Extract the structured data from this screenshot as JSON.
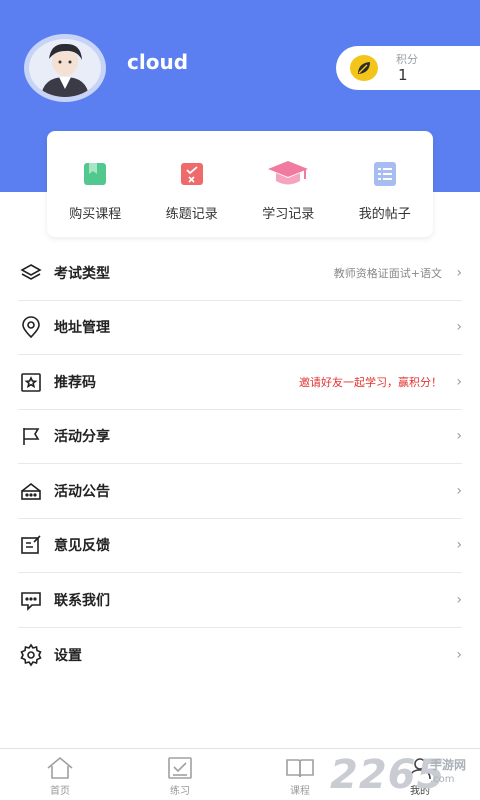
{
  "profile": {
    "username": "cloud",
    "points_label": "积分",
    "points_value": "1"
  },
  "quick_actions": [
    {
      "label": "购买课程",
      "icon": "book-icon",
      "color": "#52c78e"
    },
    {
      "label": "练题记录",
      "icon": "checklist-icon",
      "color": "#ef6b6b"
    },
    {
      "label": "学习记录",
      "icon": "graduation-cap-icon",
      "color": "#f07aa0"
    },
    {
      "label": "我的帖子",
      "icon": "list-document-icon",
      "color": "#7f9de8"
    }
  ],
  "menu": [
    {
      "label": "考试类型",
      "value": "教师资格证面试+语文",
      "icon": "layers-icon"
    },
    {
      "label": "地址管理",
      "value": "",
      "icon": "location-pin-icon"
    },
    {
      "label": "推荐码",
      "value": "邀请好友一起学习，赢积分！",
      "icon": "star-badge-icon"
    },
    {
      "label": "活动分享",
      "value": "",
      "icon": "flag-icon"
    },
    {
      "label": "活动公告",
      "value": "",
      "icon": "announcement-icon"
    },
    {
      "label": "意见反馈",
      "value": "",
      "icon": "edit-note-icon"
    },
    {
      "label": "联系我们",
      "value": "",
      "icon": "chat-bubble-icon"
    },
    {
      "label": "设置",
      "value": "",
      "icon": "gear-icon"
    }
  ],
  "tabbar": [
    {
      "label": "首页",
      "icon": "home-icon"
    },
    {
      "label": "练习",
      "icon": "practice-icon"
    },
    {
      "label": "课程",
      "icon": "open-book-icon"
    },
    {
      "label": "我的",
      "icon": "user-icon"
    }
  ],
  "watermark": {
    "number": "2265",
    "text": "手游网",
    "url": ".com"
  },
  "colors": {
    "header_blue": "#5b7ff0",
    "highlight_red": "#e3332f"
  }
}
